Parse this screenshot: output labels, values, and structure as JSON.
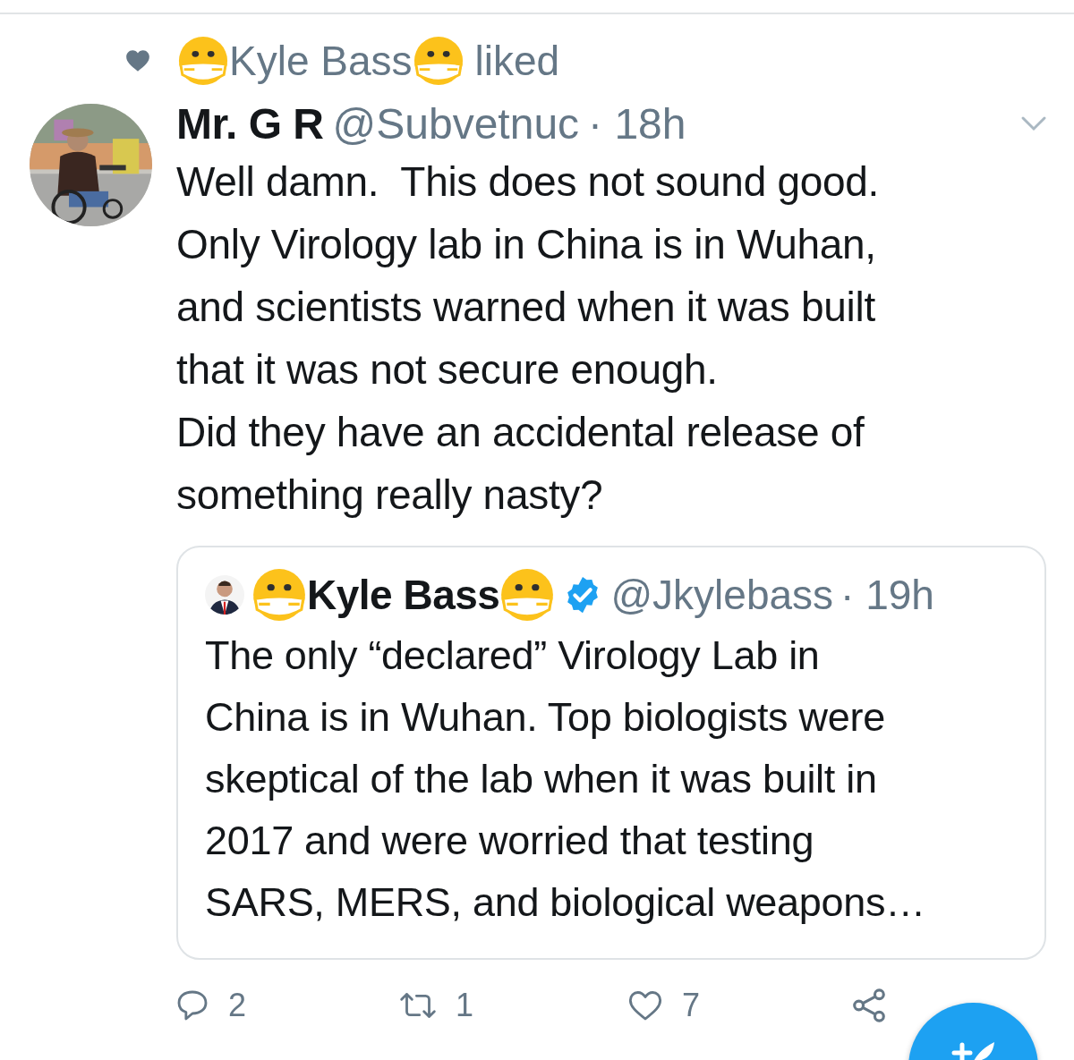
{
  "social_context": {
    "name": "Kyle Bass",
    "action": "liked"
  },
  "tweet": {
    "name": "Mr. G R",
    "handle": "@Subvetnuc",
    "time": "· 18h",
    "text": "Well damn.  This does not sound good.\nOnly Virology lab in China is in Wuhan,\nand scientists warned when it was built\nthat it was not secure enough.\nDid they have an accidental release of\nsomething really nasty?",
    "quote": {
      "name": "Kyle Bass",
      "verified": true,
      "handle": "@Jkylebass",
      "time": "· 19h",
      "text": "The only “declared” Virology Lab in\nChina is in Wuhan. Top biologists were\nskeptical of the lab when it was built in\n2017 and were worried that testing\nSARS, MERS, and biological weapons…"
    },
    "actions": [
      {
        "kind": "reply",
        "count": "2"
      },
      {
        "kind": "retweet",
        "count": "1"
      },
      {
        "kind": "like",
        "count": "7"
      },
      {
        "kind": "share"
      }
    ]
  }
}
